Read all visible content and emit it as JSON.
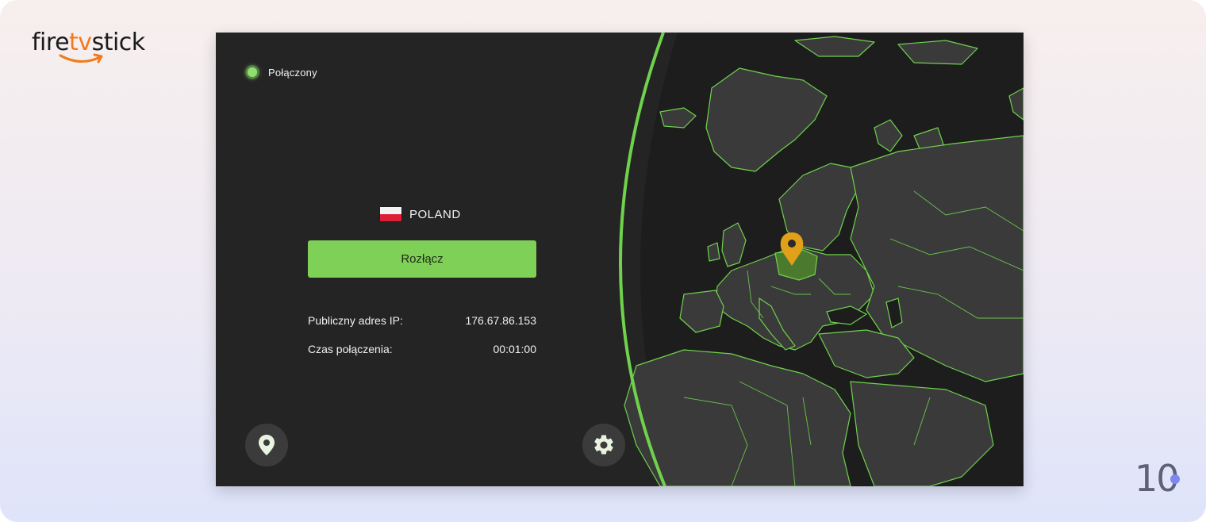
{
  "brand": {
    "logo_text_left": "fire",
    "logo_text_accent": "tv",
    "logo_text_right": "stick",
    "accent_color": "#f27a1a"
  },
  "corner_badge": {
    "text": "10",
    "dot_color": "#7e86f0"
  },
  "app": {
    "status": {
      "label": "Połączony",
      "color": "#8fe070"
    },
    "location": {
      "country": "POLAND",
      "flag_icon": "poland-flag-icon"
    },
    "disconnect_label": "Rozłącz",
    "details": [
      {
        "label": "Publiczny adres IP:",
        "value": "176.67.86.153"
      },
      {
        "label": "Czas połączenia:",
        "value": "00:01:00"
      }
    ],
    "buttons": {
      "locations_icon": "map-pin-icon",
      "settings_icon": "gear-icon"
    },
    "colors": {
      "background": "#242424",
      "accent": "#7ed056",
      "map_land": "#3a3a3a",
      "map_border": "#6fd24c",
      "highlight_country": "#4b7a2e",
      "pin": "#e2a01a"
    }
  }
}
